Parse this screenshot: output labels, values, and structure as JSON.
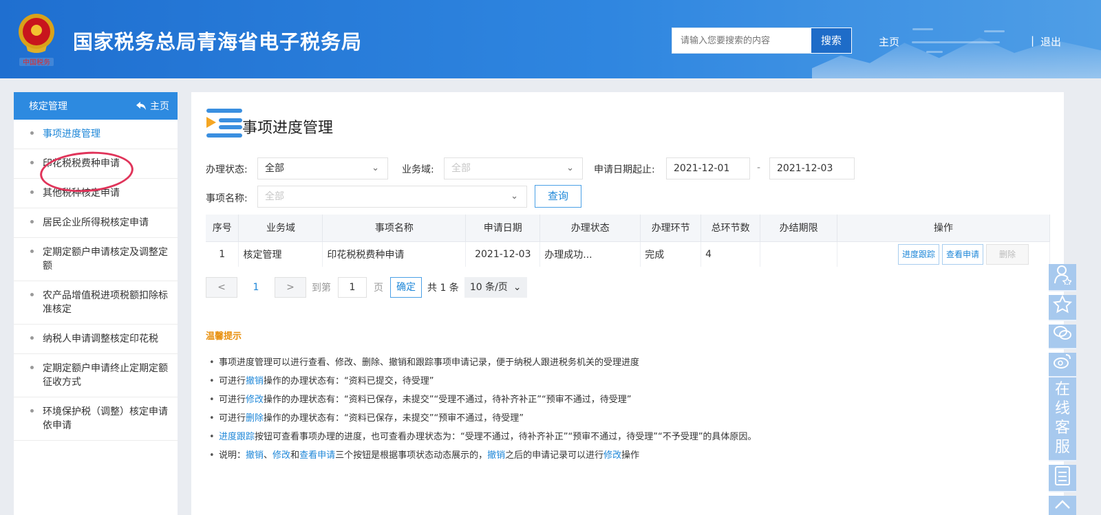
{
  "header": {
    "site_title": "国家税务总局青海省电子税务局",
    "emblem_text": "中国税务",
    "search_placeholder": "请输入您要搜索的内容",
    "search_button": "搜索",
    "home_link": "主页",
    "logout_link": "退出",
    "separator": "|"
  },
  "sidebar": {
    "header_title": "核定管理",
    "home_link": "主页",
    "items": [
      {
        "label": "事项进度管理",
        "active": true
      },
      {
        "label": "印花税税费种申请"
      },
      {
        "label": "其他税种核定申请"
      },
      {
        "label": "居民企业所得税核定申请"
      },
      {
        "label": "定期定额户申请核定及调整定额"
      },
      {
        "label": "农产品增值税进项税额扣除标准核定"
      },
      {
        "label": "纳税人申请调整核定印花税"
      },
      {
        "label": "定期定额户申请终止定期定额征收方式"
      },
      {
        "label": "环境保护税（调整）核定申请依申请"
      }
    ]
  },
  "main": {
    "title": "事项进度管理",
    "filters": {
      "status_label": "办理状态:",
      "status_value": "全部",
      "domain_label": "业务域:",
      "domain_placeholder": "全部",
      "date_label": "申请日期起止:",
      "date_start": "2021-12-01",
      "date_sep": "-",
      "date_end": "2021-12-03",
      "item_label": "事项名称:",
      "item_placeholder": "全部",
      "query_button": "查询"
    },
    "table": {
      "headers": [
        "序号",
        "业务域",
        "事项名称",
        "申请日期",
        "办理状态",
        "办理环节",
        "总环节数",
        "办结期限",
        "操作"
      ],
      "rows": [
        {
          "no": "1",
          "domain": "核定管理",
          "name": "印花税税费种申请",
          "date": "2021-12-03",
          "status": "办理成功...",
          "step": "完成",
          "total": "4",
          "deadline": ""
        }
      ],
      "actions": [
        "进度跟踪",
        "查看申请",
        "删除"
      ]
    },
    "pager": {
      "prev": "<",
      "current_page": "1",
      "next": ">",
      "goto_label": "到第",
      "goto_value": "1",
      "page_unit": "页",
      "confirm": "确定",
      "total_text": "共 1 条",
      "page_size": "10 条/页"
    },
    "tips_title": "温馨提示",
    "tips": [
      {
        "parts": [
          {
            "t": "事项进度管理可以进行查看、修改、删除、撤销和跟踪事项申请记录，便于纳税人跟进税务机关的受理进度",
            "k": false
          }
        ]
      },
      {
        "parts": [
          {
            "t": "可进行",
            "k": false
          },
          {
            "t": "撤销",
            "k": true
          },
          {
            "t": "操作的办理状态有：“资料已提交，待受理”",
            "k": false
          }
        ]
      },
      {
        "parts": [
          {
            "t": "可进行",
            "k": false
          },
          {
            "t": "修改",
            "k": true
          },
          {
            "t": "操作的办理状态有：“资料已保存，未提交”“受理不通过，待补齐补正”“预审不通过，待受理”",
            "k": false
          }
        ]
      },
      {
        "parts": [
          {
            "t": "可进行",
            "k": false
          },
          {
            "t": "删除",
            "k": true
          },
          {
            "t": "操作的办理状态有：“资料已保存，未提交”“预审不通过，待受理”",
            "k": false
          }
        ]
      },
      {
        "parts": [
          {
            "t": "进度跟踪",
            "k": true
          },
          {
            "t": "按钮可查看事项办理的进度，也可查看办理状态为：“受理不通过，待补齐补正”“预审不通过，待受理”“不予受理”的具体原因。",
            "k": false
          }
        ]
      },
      {
        "parts": [
          {
            "t": "说明：",
            "k": false
          },
          {
            "t": "撤销",
            "k": true
          },
          {
            "t": "、",
            "k": false
          },
          {
            "t": "修改",
            "k": true
          },
          {
            "t": "和",
            "k": false
          },
          {
            "t": "查看申请",
            "k": true
          },
          {
            "t": "三个按钮是根据事项状态动态展示的，",
            "k": false
          },
          {
            "t": "撤销",
            "k": true
          },
          {
            "t": "之后的申请记录可以进行",
            "k": false
          },
          {
            "t": "修改",
            "k": true
          },
          {
            "t": "操作",
            "k": false
          }
        ]
      }
    ]
  },
  "float_bar": {
    "online_service": [
      "在",
      "线",
      "客",
      "服"
    ],
    "icons": [
      "user-star-icon",
      "star-icon",
      "wechat-icon",
      "weibo-icon",
      "document-icon",
      "back-to-top-icon"
    ]
  },
  "colors": {
    "header_blue": "#2f86e0",
    "sidebar_head": "#2d8ae0",
    "link_blue": "#1e87d8",
    "tips_orange": "#e8900f",
    "annotation_red": "#e0345a"
  }
}
